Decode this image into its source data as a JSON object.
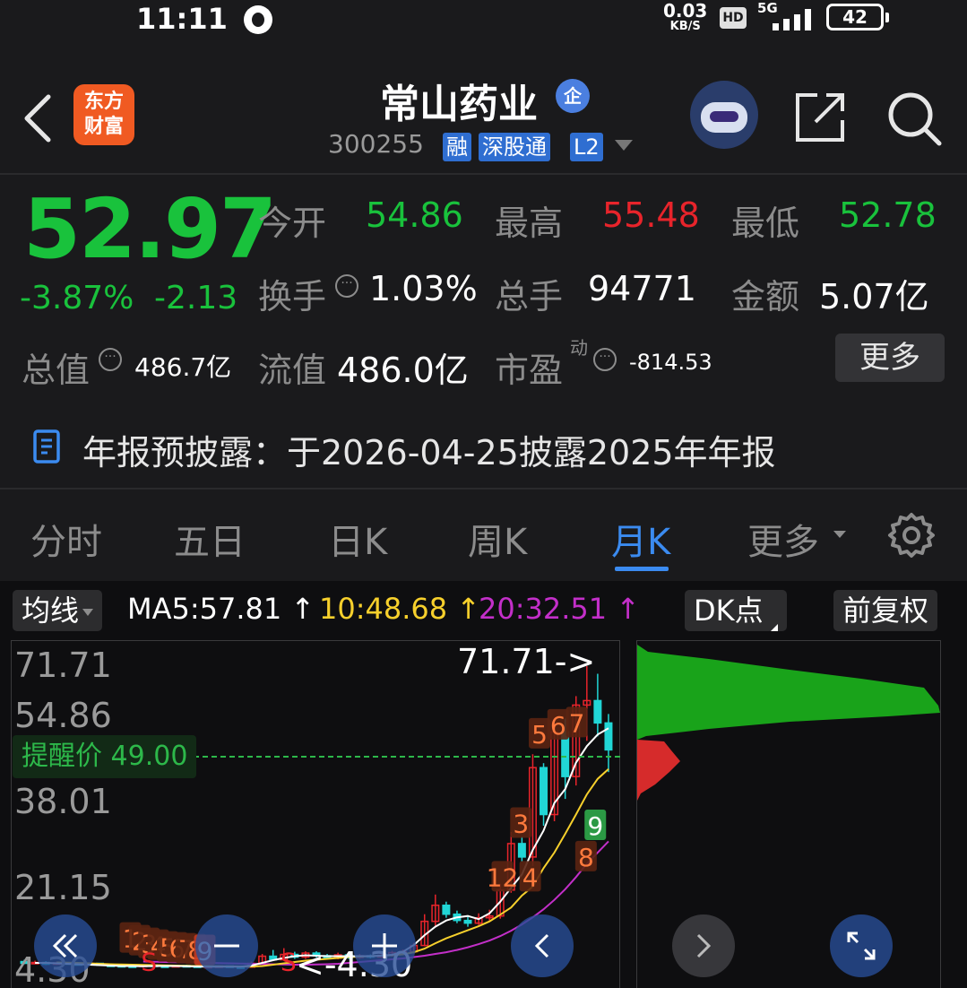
{
  "status_bar": {
    "time": "11:11",
    "speed_value": "0.03",
    "speed_unit": "KB/S",
    "hd": "HD",
    "network": "5G",
    "battery": "42"
  },
  "header": {
    "logo_text": "东方\n财富",
    "stock_name": "常山药业",
    "company_badge": "企",
    "code": "300255",
    "tags": [
      "融",
      "深股通",
      "L2"
    ]
  },
  "quote": {
    "price": "52.97",
    "change_pct": "-3.87%",
    "change_amt": "-2.13",
    "stats": [
      {
        "label": "今开",
        "value": "54.86",
        "color": "green"
      },
      {
        "label": "最高",
        "value": "55.48",
        "color": "red"
      },
      {
        "label": "最低",
        "value": "52.78",
        "color": "green"
      },
      {
        "label": "换手",
        "value": "1.03%",
        "color": "white"
      },
      {
        "label": "总手",
        "value": "94771",
        "color": "white"
      },
      {
        "label": "金额",
        "value": "5.07亿",
        "color": "white"
      },
      {
        "label": "总值",
        "value": "486.7亿",
        "color": "white"
      },
      {
        "label": "流值",
        "value": "486.0亿",
        "color": "white"
      },
      {
        "label": "市盈",
        "value": "-814.53",
        "color": "white"
      }
    ],
    "pe_superscript": "动",
    "more_label": "更多"
  },
  "notice": {
    "text": "年报预披露：于2026-04-25披露2025年年报"
  },
  "tabs": {
    "items": [
      "分时",
      "五日",
      "日K",
      "周K",
      "月K",
      "更多"
    ],
    "active": "月K"
  },
  "chart_toolbar": {
    "indicator_label": "均线",
    "ma5": "MA5:57.81",
    "ma10": "10:48.68",
    "ma20": "20:32.51",
    "dk_label": "DK点",
    "adjust_label": "前复权"
  },
  "chart_data": {
    "type": "candlestick",
    "period": "monthly",
    "y_ticks": [
      "71.71",
      "54.86",
      "38.01",
      "21.15",
      "4.30"
    ],
    "ylim": [
      4.3,
      71.71
    ],
    "alert_price_label": "提醒价 49.00",
    "alert_price": 49.0,
    "high_marker": "71.71->",
    "low_marker": "<-4.30",
    "signal_labels": [
      "1",
      "2",
      "3",
      "4",
      "5",
      "6",
      "7",
      "8",
      "9",
      "S",
      "S",
      "12",
      "4",
      "3",
      "5",
      "6",
      "7",
      "8",
      "9"
    ],
    "colors": {
      "up": "#e8242b",
      "down": "#21d6d6",
      "ma5": "#ffffff",
      "ma10": "#f7d02c",
      "ma20": "#c32fc9",
      "volume_profile_upper": "#19a31a",
      "volume_profile_lower": "#d62b2b"
    },
    "candles": [
      {
        "o": 5.6,
        "c": 5.2,
        "h": 6.0,
        "l": 5.0
      },
      {
        "o": 5.2,
        "c": 5.4,
        "h": 5.8,
        "l": 5.0
      },
      {
        "o": 5.4,
        "c": 5.0,
        "h": 5.7,
        "l": 4.8
      },
      {
        "o": 5.0,
        "c": 5.3,
        "h": 5.6,
        "l": 4.8
      },
      {
        "o": 5.3,
        "c": 5.1,
        "h": 5.5,
        "l": 4.9
      },
      {
        "o": 5.1,
        "c": 4.9,
        "h": 5.4,
        "l": 4.7
      },
      {
        "o": 4.9,
        "c": 5.2,
        "h": 5.4,
        "l": 4.7
      },
      {
        "o": 5.2,
        "c": 4.8,
        "h": 5.3,
        "l": 4.6
      },
      {
        "o": 4.8,
        "c": 4.7,
        "h": 5.1,
        "l": 4.5
      },
      {
        "o": 4.7,
        "c": 4.6,
        "h": 4.9,
        "l": 4.4
      },
      {
        "o": 4.6,
        "c": 4.5,
        "h": 4.8,
        "l": 4.3
      },
      {
        "o": 4.5,
        "c": 4.8,
        "h": 5.0,
        "l": 4.3
      },
      {
        "o": 4.8,
        "c": 4.6,
        "h": 5.0,
        "l": 4.4
      },
      {
        "o": 4.6,
        "c": 4.5,
        "h": 4.8,
        "l": 4.3
      },
      {
        "o": 4.5,
        "c": 4.7,
        "h": 4.9,
        "l": 4.3
      },
      {
        "o": 4.7,
        "c": 4.6,
        "h": 4.9,
        "l": 4.4
      },
      {
        "o": 4.6,
        "c": 4.4,
        "h": 4.8,
        "l": 4.3
      },
      {
        "o": 4.4,
        "c": 4.5,
        "h": 4.7,
        "l": 4.3
      },
      {
        "o": 4.5,
        "c": 4.6,
        "h": 4.8,
        "l": 4.3
      },
      {
        "o": 4.6,
        "c": 4.4,
        "h": 4.7,
        "l": 4.3
      },
      {
        "o": 4.4,
        "c": 4.35,
        "h": 4.6,
        "l": 4.3
      },
      {
        "o": 4.35,
        "c": 5.2,
        "h": 5.6,
        "l": 4.3
      },
      {
        "o": 5.2,
        "c": 6.8,
        "h": 7.3,
        "l": 5.0
      },
      {
        "o": 6.8,
        "c": 6.0,
        "h": 8.2,
        "l": 5.8
      },
      {
        "o": 6.0,
        "c": 7.2,
        "h": 8.6,
        "l": 5.8
      },
      {
        "o": 7.2,
        "c": 6.6,
        "h": 7.8,
        "l": 6.2
      },
      {
        "o": 6.6,
        "c": 7.5,
        "h": 7.9,
        "l": 6.2
      },
      {
        "o": 7.5,
        "c": 6.9,
        "h": 7.9,
        "l": 6.5
      },
      {
        "o": 6.9,
        "c": 6.4,
        "h": 7.3,
        "l": 6.0
      },
      {
        "o": 6.4,
        "c": 7.1,
        "h": 7.6,
        "l": 6.1
      },
      {
        "o": 7.1,
        "c": 6.5,
        "h": 7.4,
        "l": 6.2
      },
      {
        "o": 6.5,
        "c": 6.9,
        "h": 7.3,
        "l": 6.2
      },
      {
        "o": 6.9,
        "c": 6.6,
        "h": 7.2,
        "l": 6.3
      },
      {
        "o": 6.6,
        "c": 7.0,
        "h": 7.4,
        "l": 6.3
      },
      {
        "o": 7.0,
        "c": 7.6,
        "h": 8.0,
        "l": 6.7
      },
      {
        "o": 7.6,
        "c": 7.8,
        "h": 8.3,
        "l": 7.2
      },
      {
        "o": 7.8,
        "c": 9.2,
        "h": 9.8,
        "l": 7.4
      },
      {
        "o": 9.2,
        "c": 14.6,
        "h": 16.2,
        "l": 9.0
      },
      {
        "o": 14.6,
        "c": 18.2,
        "h": 20.6,
        "l": 13.6
      },
      {
        "o": 18.2,
        "c": 16.2,
        "h": 19.0,
        "l": 15.4
      },
      {
        "o": 16.2,
        "c": 14.8,
        "h": 17.0,
        "l": 14.2
      },
      {
        "o": 14.8,
        "c": 14.2,
        "h": 15.6,
        "l": 13.4
      },
      {
        "o": 14.2,
        "c": 15.4,
        "h": 16.4,
        "l": 13.8
      },
      {
        "o": 15.4,
        "c": 15.8,
        "h": 17.2,
        "l": 14.8
      },
      {
        "o": 15.8,
        "c": 21.6,
        "h": 23.0,
        "l": 15.2
      },
      {
        "o": 21.6,
        "c": 32.0,
        "h": 34.6,
        "l": 21.0
      },
      {
        "o": 32.0,
        "c": 29.0,
        "h": 33.6,
        "l": 28.0
      },
      {
        "o": 29.0,
        "c": 49.0,
        "h": 52.0,
        "l": 27.0
      },
      {
        "o": 49.0,
        "c": 38.5,
        "h": 50.0,
        "l": 36.0
      },
      {
        "o": 38.5,
        "c": 57.0,
        "h": 59.0,
        "l": 37.0
      },
      {
        "o": 57.0,
        "c": 47.0,
        "h": 60.0,
        "l": 42.0
      },
      {
        "o": 47.0,
        "c": 63.0,
        "h": 65.0,
        "l": 45.0
      },
      {
        "o": 63.0,
        "c": 64.0,
        "h": 71.71,
        "l": 55.0
      },
      {
        "o": 64.0,
        "c": 59.0,
        "h": 70.0,
        "l": 56.0
      },
      {
        "o": 59.0,
        "c": 52.97,
        "h": 61.0,
        "l": 48.0
      }
    ],
    "ma5_line": [
      5.3,
      5.3,
      5.2,
      5.1,
      5.0,
      4.9,
      4.8,
      4.7,
      4.6,
      4.6,
      4.55,
      4.6,
      4.6,
      4.6,
      4.55,
      4.5,
      4.45,
      4.45,
      4.45,
      4.45,
      4.7,
      5.3,
      5.9,
      6.4,
      6.8,
      7.0,
      6.9,
      6.8,
      6.8,
      6.8,
      6.8,
      6.8,
      6.9,
      7.1,
      7.8,
      9.3,
      11.5,
      13.4,
      14.8,
      15.5,
      15.8,
      15.1,
      16.4,
      19.0,
      22.1,
      25.1,
      30.6,
      34.9,
      41.1,
      44.2,
      50.1,
      53.8,
      56.4,
      57.81
    ],
    "ma10_line": [
      5.4,
      5.35,
      5.3,
      5.2,
      5.1,
      5.0,
      4.95,
      4.9,
      4.85,
      4.8,
      4.75,
      4.7,
      4.65,
      4.6,
      4.58,
      4.55,
      4.52,
      4.5,
      4.48,
      4.6,
      4.9,
      5.2,
      5.5,
      5.8,
      6.0,
      6.2,
      6.4,
      6.6,
      6.7,
      6.8,
      6.9,
      7.0,
      7.2,
      7.7,
      8.5,
      9.7,
      10.8,
      11.7,
      12.6,
      13.5,
      14.6,
      16.1,
      17.7,
      20.4,
      22.4,
      26.5,
      30.0,
      34.2,
      38.5,
      43.0,
      46.5,
      48.68
    ],
    "ma20_line": [
      5.6,
      5.55,
      5.5,
      5.45,
      5.4,
      5.35,
      5.3,
      5.25,
      5.2,
      5.15,
      5.1,
      5.05,
      5.0,
      4.95,
      4.9,
      4.9,
      4.95,
      5.0,
      5.1,
      5.3,
      5.5,
      5.7,
      5.9,
      6.1,
      6.3,
      6.6,
      6.9,
      7.3,
      7.7,
      8.2,
      8.8,
      9.5,
      10.3,
      11.3,
      12.5,
      13.9,
      15.5,
      17.3,
      19.4,
      21.8,
      24.5,
      27.5,
      30.0,
      32.51
    ]
  }
}
